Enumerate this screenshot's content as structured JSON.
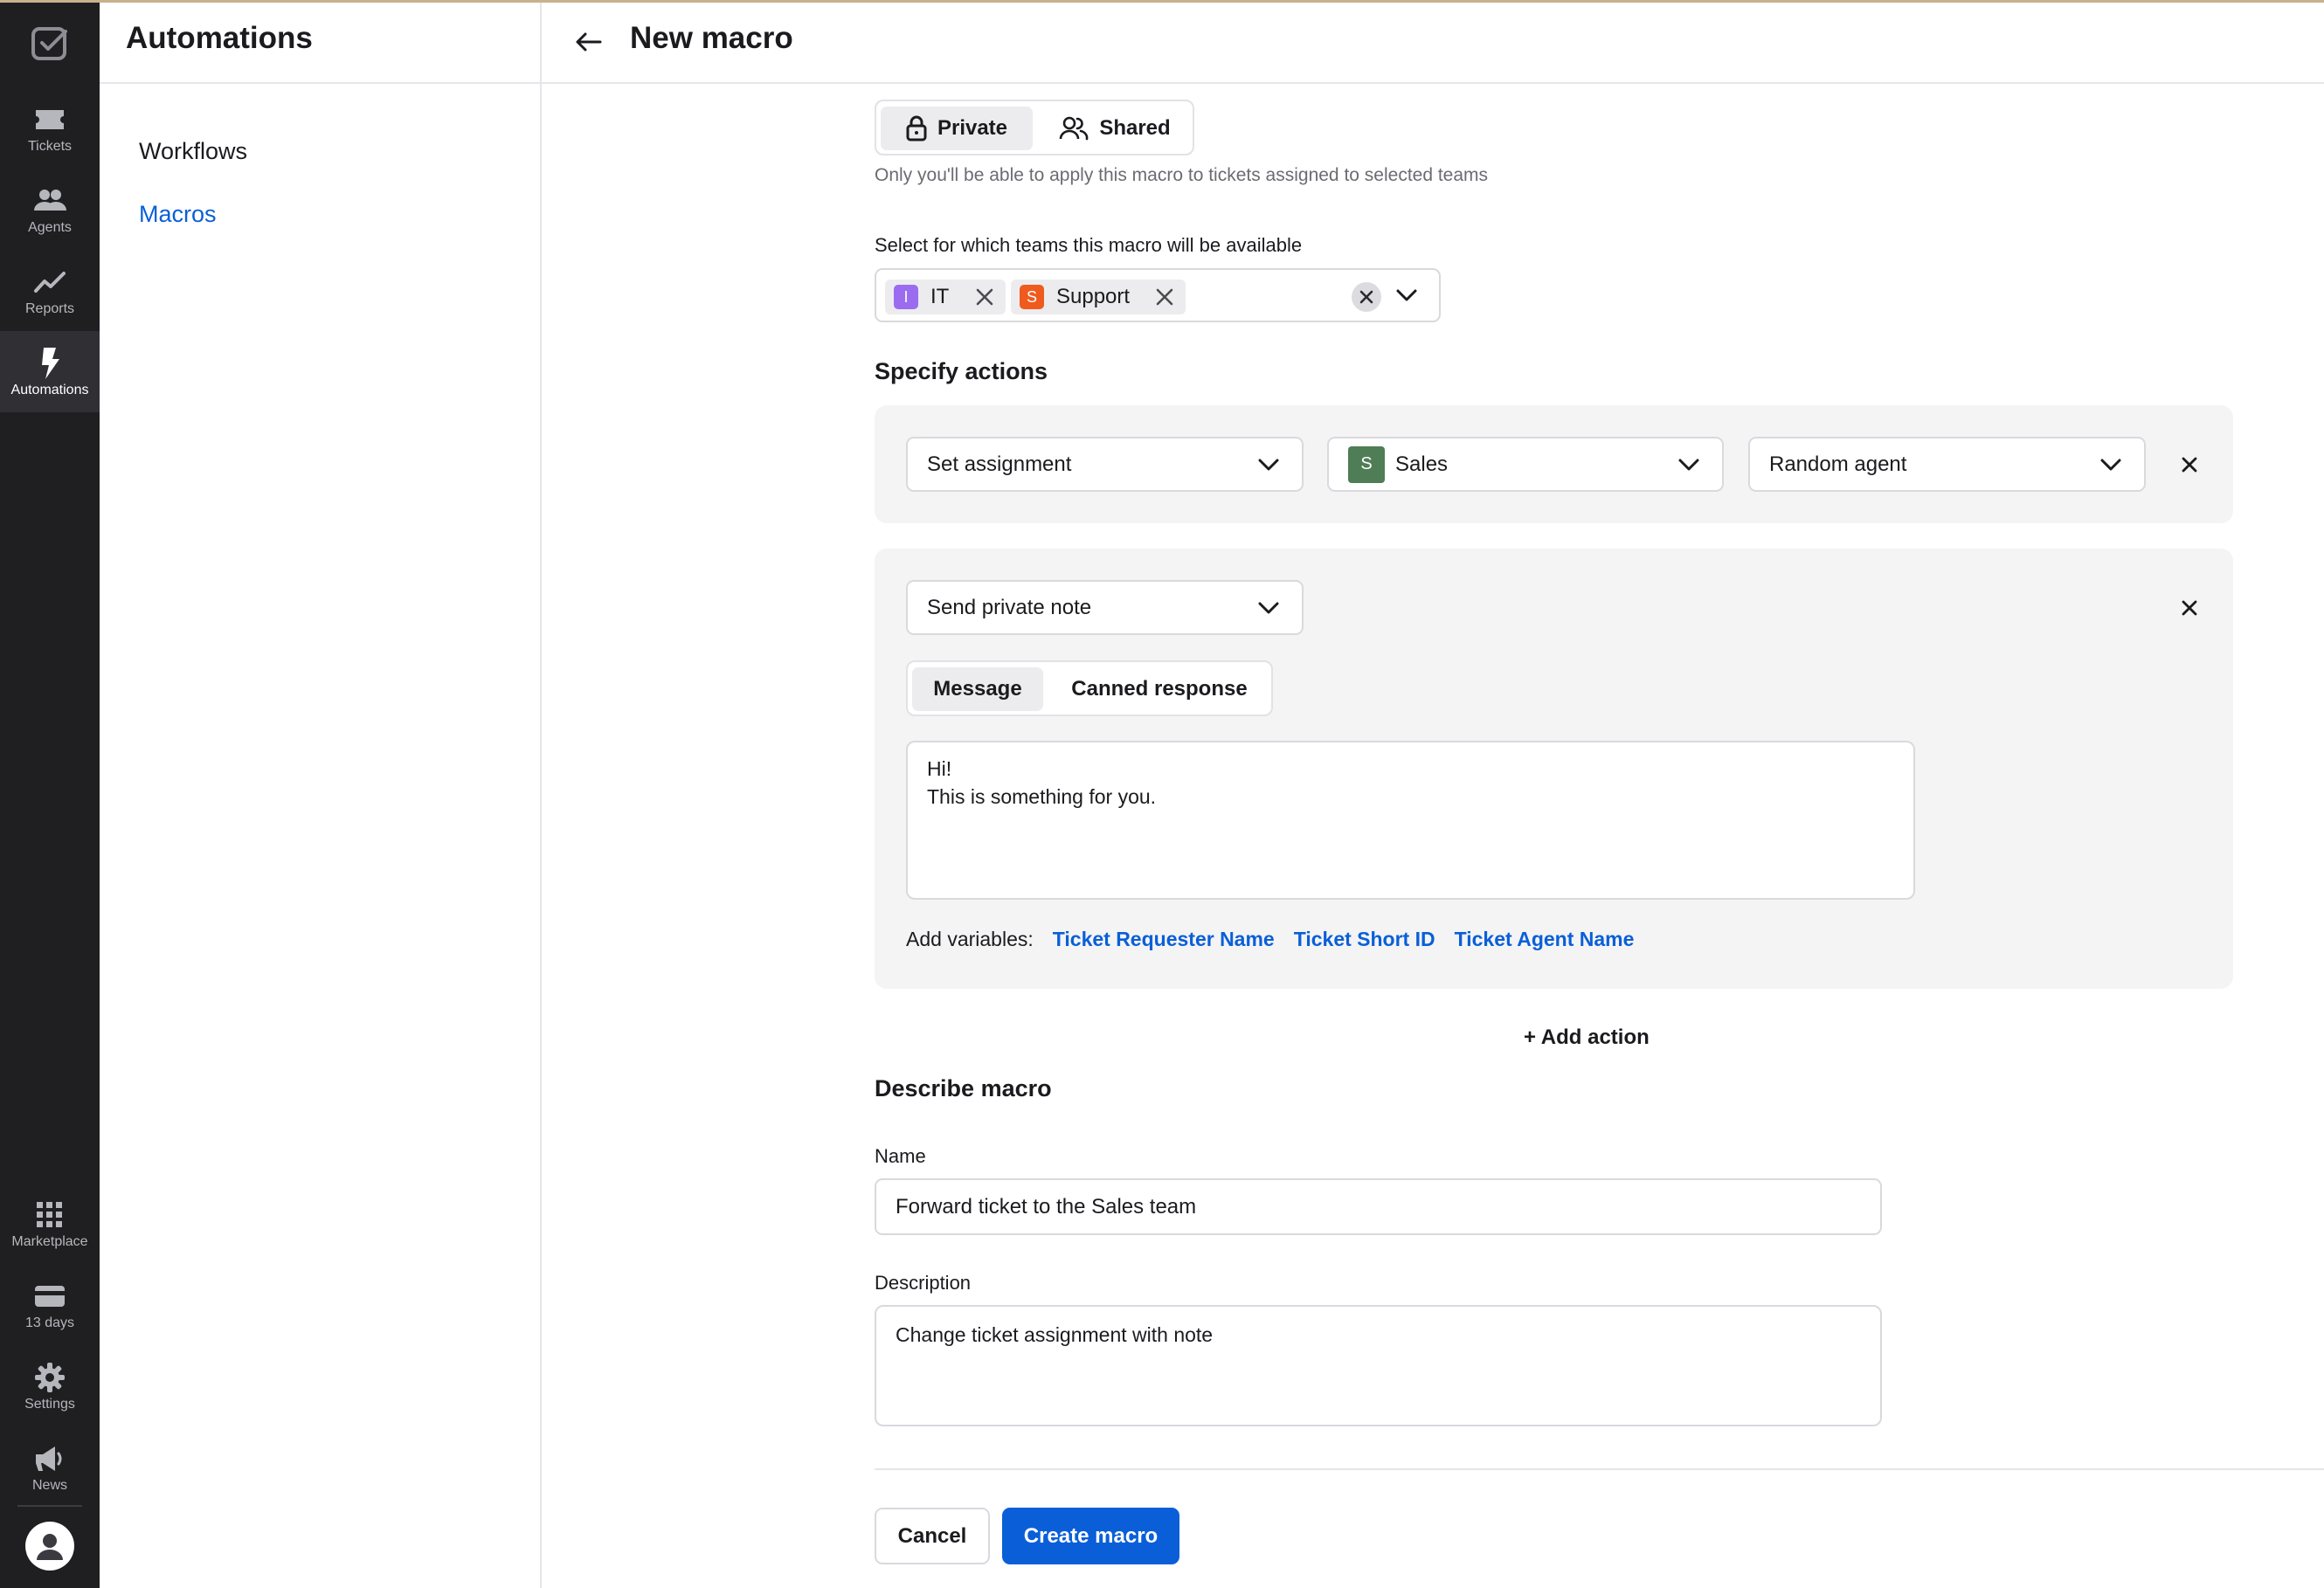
{
  "rail": {
    "items": [
      {
        "label": "Tickets",
        "icon": "ticket-icon"
      },
      {
        "label": "Agents",
        "icon": "agents-icon"
      },
      {
        "label": "Reports",
        "icon": "reports-icon"
      },
      {
        "label": "Automations",
        "icon": "bolt-icon"
      }
    ],
    "bottom_items": [
      {
        "label": "Marketplace",
        "icon": "grid-icon"
      },
      {
        "label": "13 days",
        "icon": "card-icon"
      },
      {
        "label": "Settings",
        "icon": "gear-icon"
      },
      {
        "label": "News",
        "icon": "megaphone-icon"
      }
    ]
  },
  "subnav": {
    "title": "Automations",
    "links": [
      {
        "label": "Workflows",
        "active": false
      },
      {
        "label": "Macros",
        "active": true
      }
    ]
  },
  "header": {
    "title": "New macro"
  },
  "visibility": {
    "options": [
      "Private",
      "Shared"
    ],
    "selected": "Private",
    "help": "Only you'll be able to apply this macro to tickets assigned to selected teams"
  },
  "teams": {
    "label": "Select for which teams this macro will be available",
    "tags": [
      {
        "letter": "I",
        "name": "IT",
        "color": "#9b6cf0"
      },
      {
        "letter": "S",
        "name": "Support",
        "color": "#f05a1e"
      }
    ]
  },
  "actions": {
    "title": "Specify actions",
    "assignment": {
      "action": "Set assignment",
      "team_letter": "S",
      "team": "Sales",
      "team_color": "#4f7d55",
      "agent": "Random agent"
    },
    "note": {
      "action": "Send private note",
      "tabs": [
        "Message",
        "Canned response"
      ],
      "selected_tab": "Message",
      "message_line1": "Hi!",
      "message_line2": "This is something for you.",
      "variables_label": "Add variables:",
      "variables": [
        "Ticket Requester Name",
        "Ticket Short ID",
        "Ticket Agent Name"
      ]
    },
    "add_action": "+ Add action"
  },
  "describe": {
    "title": "Describe macro",
    "name_label": "Name",
    "name_value": "Forward ticket to the Sales team",
    "description_label": "Description",
    "description_value": "Change ticket assignment with note"
  },
  "footer": {
    "cancel": "Cancel",
    "create": "Create macro"
  },
  "colors": {
    "accent": "#0a5fd8",
    "rail_bg": "#1f1f22",
    "card_bg": "#f4f4f5"
  }
}
